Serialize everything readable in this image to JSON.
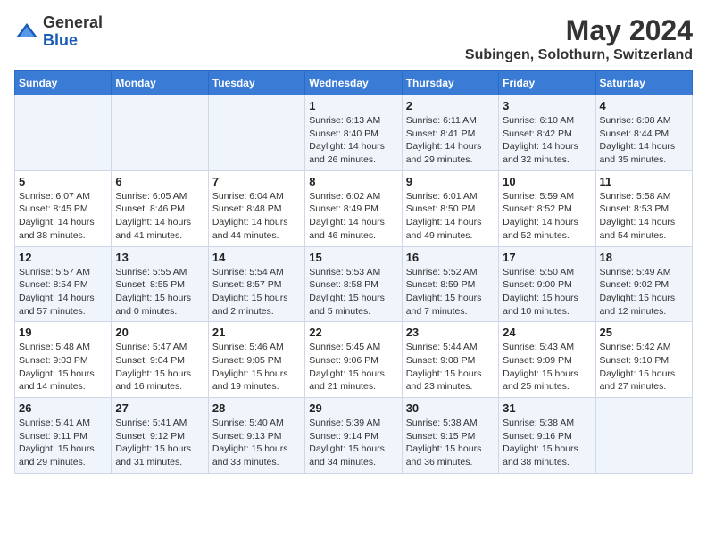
{
  "logo": {
    "general": "General",
    "blue": "Blue"
  },
  "title": "May 2024",
  "subtitle": "Subingen, Solothurn, Switzerland",
  "days_of_week": [
    "Sunday",
    "Monday",
    "Tuesday",
    "Wednesday",
    "Thursday",
    "Friday",
    "Saturday"
  ],
  "weeks": [
    [
      {
        "day": "",
        "info": ""
      },
      {
        "day": "",
        "info": ""
      },
      {
        "day": "",
        "info": ""
      },
      {
        "day": "1",
        "info": "Sunrise: 6:13 AM\nSunset: 8:40 PM\nDaylight: 14 hours and 26 minutes."
      },
      {
        "day": "2",
        "info": "Sunrise: 6:11 AM\nSunset: 8:41 PM\nDaylight: 14 hours and 29 minutes."
      },
      {
        "day": "3",
        "info": "Sunrise: 6:10 AM\nSunset: 8:42 PM\nDaylight: 14 hours and 32 minutes."
      },
      {
        "day": "4",
        "info": "Sunrise: 6:08 AM\nSunset: 8:44 PM\nDaylight: 14 hours and 35 minutes."
      }
    ],
    [
      {
        "day": "5",
        "info": "Sunrise: 6:07 AM\nSunset: 8:45 PM\nDaylight: 14 hours and 38 minutes."
      },
      {
        "day": "6",
        "info": "Sunrise: 6:05 AM\nSunset: 8:46 PM\nDaylight: 14 hours and 41 minutes."
      },
      {
        "day": "7",
        "info": "Sunrise: 6:04 AM\nSunset: 8:48 PM\nDaylight: 14 hours and 44 minutes."
      },
      {
        "day": "8",
        "info": "Sunrise: 6:02 AM\nSunset: 8:49 PM\nDaylight: 14 hours and 46 minutes."
      },
      {
        "day": "9",
        "info": "Sunrise: 6:01 AM\nSunset: 8:50 PM\nDaylight: 14 hours and 49 minutes."
      },
      {
        "day": "10",
        "info": "Sunrise: 5:59 AM\nSunset: 8:52 PM\nDaylight: 14 hours and 52 minutes."
      },
      {
        "day": "11",
        "info": "Sunrise: 5:58 AM\nSunset: 8:53 PM\nDaylight: 14 hours and 54 minutes."
      }
    ],
    [
      {
        "day": "12",
        "info": "Sunrise: 5:57 AM\nSunset: 8:54 PM\nDaylight: 14 hours and 57 minutes."
      },
      {
        "day": "13",
        "info": "Sunrise: 5:55 AM\nSunset: 8:55 PM\nDaylight: 15 hours and 0 minutes."
      },
      {
        "day": "14",
        "info": "Sunrise: 5:54 AM\nSunset: 8:57 PM\nDaylight: 15 hours and 2 minutes."
      },
      {
        "day": "15",
        "info": "Sunrise: 5:53 AM\nSunset: 8:58 PM\nDaylight: 15 hours and 5 minutes."
      },
      {
        "day": "16",
        "info": "Sunrise: 5:52 AM\nSunset: 8:59 PM\nDaylight: 15 hours and 7 minutes."
      },
      {
        "day": "17",
        "info": "Sunrise: 5:50 AM\nSunset: 9:00 PM\nDaylight: 15 hours and 10 minutes."
      },
      {
        "day": "18",
        "info": "Sunrise: 5:49 AM\nSunset: 9:02 PM\nDaylight: 15 hours and 12 minutes."
      }
    ],
    [
      {
        "day": "19",
        "info": "Sunrise: 5:48 AM\nSunset: 9:03 PM\nDaylight: 15 hours and 14 minutes."
      },
      {
        "day": "20",
        "info": "Sunrise: 5:47 AM\nSunset: 9:04 PM\nDaylight: 15 hours and 16 minutes."
      },
      {
        "day": "21",
        "info": "Sunrise: 5:46 AM\nSunset: 9:05 PM\nDaylight: 15 hours and 19 minutes."
      },
      {
        "day": "22",
        "info": "Sunrise: 5:45 AM\nSunset: 9:06 PM\nDaylight: 15 hours and 21 minutes."
      },
      {
        "day": "23",
        "info": "Sunrise: 5:44 AM\nSunset: 9:08 PM\nDaylight: 15 hours and 23 minutes."
      },
      {
        "day": "24",
        "info": "Sunrise: 5:43 AM\nSunset: 9:09 PM\nDaylight: 15 hours and 25 minutes."
      },
      {
        "day": "25",
        "info": "Sunrise: 5:42 AM\nSunset: 9:10 PM\nDaylight: 15 hours and 27 minutes."
      }
    ],
    [
      {
        "day": "26",
        "info": "Sunrise: 5:41 AM\nSunset: 9:11 PM\nDaylight: 15 hours and 29 minutes."
      },
      {
        "day": "27",
        "info": "Sunrise: 5:41 AM\nSunset: 9:12 PM\nDaylight: 15 hours and 31 minutes."
      },
      {
        "day": "28",
        "info": "Sunrise: 5:40 AM\nSunset: 9:13 PM\nDaylight: 15 hours and 33 minutes."
      },
      {
        "day": "29",
        "info": "Sunrise: 5:39 AM\nSunset: 9:14 PM\nDaylight: 15 hours and 34 minutes."
      },
      {
        "day": "30",
        "info": "Sunrise: 5:38 AM\nSunset: 9:15 PM\nDaylight: 15 hours and 36 minutes."
      },
      {
        "day": "31",
        "info": "Sunrise: 5:38 AM\nSunset: 9:16 PM\nDaylight: 15 hours and 38 minutes."
      },
      {
        "day": "",
        "info": ""
      }
    ]
  ]
}
